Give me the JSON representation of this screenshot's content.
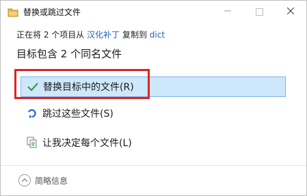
{
  "window": {
    "title": "替换或跳过文件",
    "icon": "folder-icon",
    "caption_buttons": {
      "minimize": "minimize-icon",
      "maximize": "maximize-icon",
      "close": "close-icon"
    }
  },
  "description": {
    "prefix": "正在将 2 个项目从",
    "source": "汉化补丁",
    "middle": "复制到",
    "destination": "dict"
  },
  "heading": "目标包含 2 个同名文件",
  "options": [
    {
      "label": "替换目标中的文件(R)",
      "icon": "checkmark-icon",
      "selected": true
    },
    {
      "label": "跳过这些文件(S)",
      "icon": "skip-arrow-icon"
    },
    {
      "label": "让我决定每个文件(L)",
      "icon": "file-compare-icon"
    }
  ],
  "footer": {
    "details_label": "简略信息",
    "icon": "chevron-up-icon"
  },
  "colors": {
    "link": "#1f5fb3",
    "selection": "#cde8fb",
    "highlight_box": "#e02020"
  }
}
